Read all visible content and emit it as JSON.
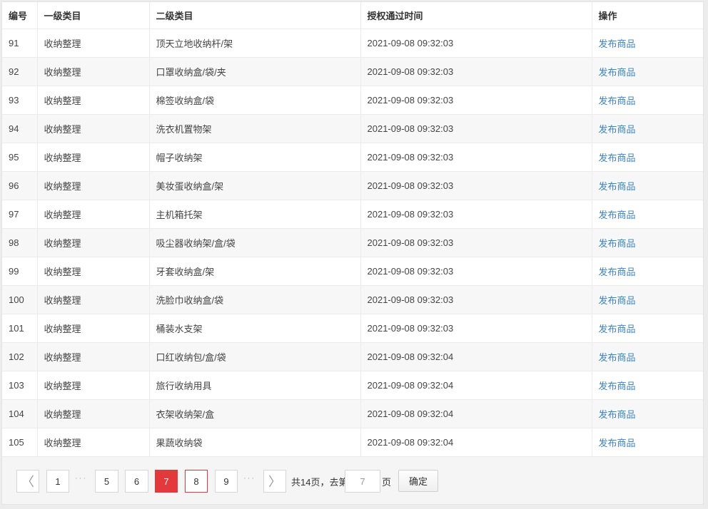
{
  "table": {
    "headers": [
      "编号",
      "一级类目",
      "二级类目",
      "授权通过时间",
      "操作"
    ],
    "rows": [
      {
        "id": "91",
        "cat1": "收纳整理",
        "cat2": "顶天立地收纳杆/架",
        "time": "2021-09-08 09:32:03",
        "action": "发布商品"
      },
      {
        "id": "92",
        "cat1": "收纳整理",
        "cat2": "口罩收纳盒/袋/夹",
        "time": "2021-09-08 09:32:03",
        "action": "发布商品"
      },
      {
        "id": "93",
        "cat1": "收纳整理",
        "cat2": "棉签收纳盒/袋",
        "time": "2021-09-08 09:32:03",
        "action": "发布商品"
      },
      {
        "id": "94",
        "cat1": "收纳整理",
        "cat2": "洗衣机置物架",
        "time": "2021-09-08 09:32:03",
        "action": "发布商品"
      },
      {
        "id": "95",
        "cat1": "收纳整理",
        "cat2": "帽子收纳架",
        "time": "2021-09-08 09:32:03",
        "action": "发布商品"
      },
      {
        "id": "96",
        "cat1": "收纳整理",
        "cat2": "美妆蛋收纳盒/架",
        "time": "2021-09-08 09:32:03",
        "action": "发布商品"
      },
      {
        "id": "97",
        "cat1": "收纳整理",
        "cat2": "主机箱托架",
        "time": "2021-09-08 09:32:03",
        "action": "发布商品"
      },
      {
        "id": "98",
        "cat1": "收纳整理",
        "cat2": "吸尘器收纳架/盒/袋",
        "time": "2021-09-08 09:32:03",
        "action": "发布商品"
      },
      {
        "id": "99",
        "cat1": "收纳整理",
        "cat2": "牙套收纳盒/架",
        "time": "2021-09-08 09:32:03",
        "action": "发布商品"
      },
      {
        "id": "100",
        "cat1": "收纳整理",
        "cat2": "洗脸巾收纳盒/袋",
        "time": "2021-09-08 09:32:03",
        "action": "发布商品"
      },
      {
        "id": "101",
        "cat1": "收纳整理",
        "cat2": "桶装水支架",
        "time": "2021-09-08 09:32:03",
        "action": "发布商品"
      },
      {
        "id": "102",
        "cat1": "收纳整理",
        "cat2": "口红收纳包/盒/袋",
        "time": "2021-09-08 09:32:04",
        "action": "发布商品"
      },
      {
        "id": "103",
        "cat1": "收纳整理",
        "cat2": "旅行收纳用具",
        "time": "2021-09-08 09:32:04",
        "action": "发布商品"
      },
      {
        "id": "104",
        "cat1": "收纳整理",
        "cat2": "衣架收纳架/盒",
        "time": "2021-09-08 09:32:04",
        "action": "发布商品"
      },
      {
        "id": "105",
        "cat1": "收纳整理",
        "cat2": "果蔬收纳袋",
        "time": "2021-09-08 09:32:04",
        "action": "发布商品"
      }
    ]
  },
  "pagination": {
    "prev_icon": "chevron-left-icon",
    "next_icon": "chevron-right-icon",
    "prev_glyph": "〈",
    "next_glyph": "〉",
    "pages": [
      "1",
      "5",
      "6",
      "7",
      "8",
      "9"
    ],
    "current": "7",
    "hovered": "8",
    "ellipsis": "···",
    "total_text": "共14页，去第",
    "goto_value": "7",
    "page_suffix": "页",
    "confirm_label": "确定"
  },
  "colors": {
    "accent": "#e4393c",
    "link": "#3a83c9"
  }
}
